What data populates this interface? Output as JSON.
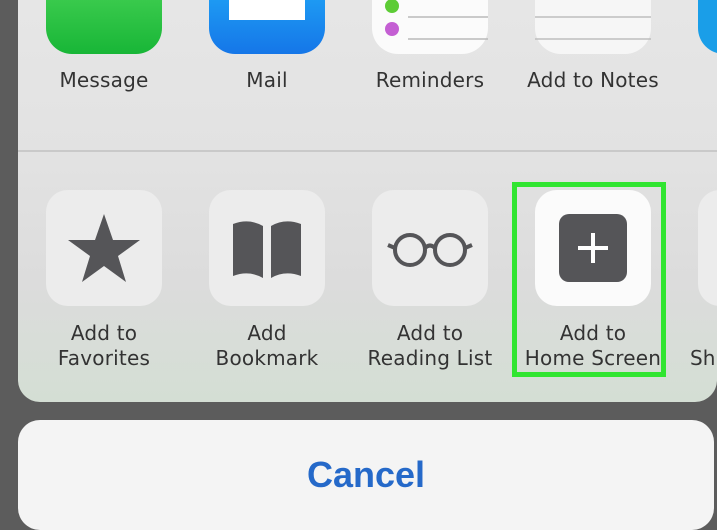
{
  "top_row": {
    "items": [
      {
        "label": "Message",
        "icon": "messages-app-icon"
      },
      {
        "label": "Mail",
        "icon": "mail-app-icon"
      },
      {
        "label": "Reminders",
        "icon": "reminders-app-icon"
      },
      {
        "label": "Add to Notes",
        "icon": "notes-app-icon"
      }
    ]
  },
  "actions": {
    "items": [
      {
        "line1": "Add to",
        "line2": "Favorites",
        "icon": "star-icon"
      },
      {
        "line1": "Add",
        "line2": "Bookmark",
        "icon": "book-icon"
      },
      {
        "line1": "Add to",
        "line2": "Reading List",
        "icon": "glasses-icon"
      },
      {
        "line1": "Add to",
        "line2": "Home Screen",
        "icon": "plus-square-icon"
      },
      {
        "line1": "",
        "line2": "Sh",
        "icon": "partial-share-icon"
      }
    ]
  },
  "cancel": {
    "label": "Cancel"
  },
  "colors": {
    "highlight": "#31e531",
    "cancel_text": "#2569c9",
    "messages_green": "#2fc34a",
    "mail_blue": "#1aa3f5"
  }
}
